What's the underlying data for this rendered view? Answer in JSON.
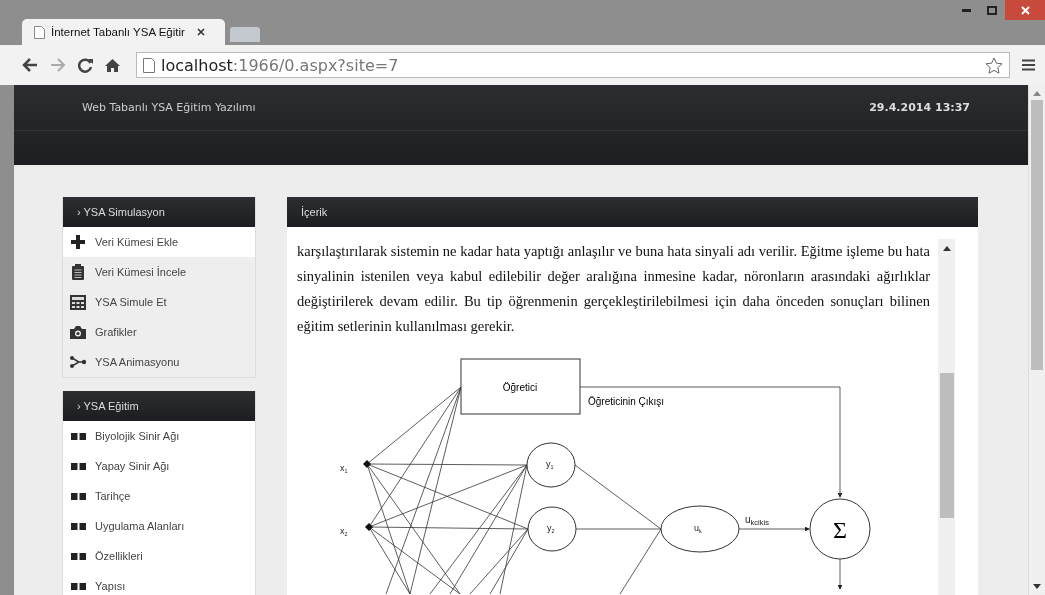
{
  "browser": {
    "tab_title": "İnternet Tabanlı YSA Eğitir",
    "url_host": "localhost",
    "url_rest": ":1966/0.aspx?site=7"
  },
  "header": {
    "title": "Web Tabanlı YSA Eğitim Yazılımı",
    "datetime": "29.4.2014 13:37"
  },
  "sidebar": [
    {
      "title": "› YSA Simulasyon",
      "items": [
        {
          "label": "Veri Kümesi Ekle",
          "selected": true
        },
        {
          "label": "Veri Kümesi İncele",
          "selected": false
        },
        {
          "label": "YSA Simule Et",
          "selected": false
        },
        {
          "label": "Grafikler",
          "selected": false
        },
        {
          "label": "YSA Animasyonu",
          "selected": false
        }
      ]
    },
    {
      "title": "› YSA Eğitim",
      "items": [
        {
          "label": "Biyolojik Sinir Ağı"
        },
        {
          "label": "Yapay Sinir Ağı"
        },
        {
          "label": "Tarihçe"
        },
        {
          "label": "Uygulama Alanları"
        },
        {
          "label": "Özellikleri"
        },
        {
          "label": "Yapısı"
        }
      ]
    }
  ],
  "content": {
    "title": "İçerik",
    "paragraph": "karşılaştırılarak sistemin ne kadar hata yaptığı anlaşılır ve buna hata sinyali adı verilir. Eğitme işleme bu hata sinyalinin istenilen veya kabul edilebilir değer aralığına inmesine kadar, nöronların arasındaki ağırlıklar değiştirilerek devam edilir. Bu tip öğrenmenin gerçekleştirilebilmesi için daha önceden sonuçları bilinen eğitim setlerinin kullanılması gerekir.",
    "diagram": {
      "teacher": "Öğretici",
      "teacher_output": "Öğreticinin Çıkışı",
      "inputs": [
        {
          "main": "x",
          "sub": "1"
        },
        {
          "main": "x",
          "sub": "2"
        }
      ],
      "hidden": [
        {
          "main": "y",
          "sub": "1"
        },
        {
          "main": "y",
          "sub": "2"
        }
      ],
      "output": {
        "main": "u",
        "sub": "k"
      },
      "output_label": {
        "main": "u",
        "sub": "kcikis"
      },
      "sum": "Σ"
    }
  }
}
